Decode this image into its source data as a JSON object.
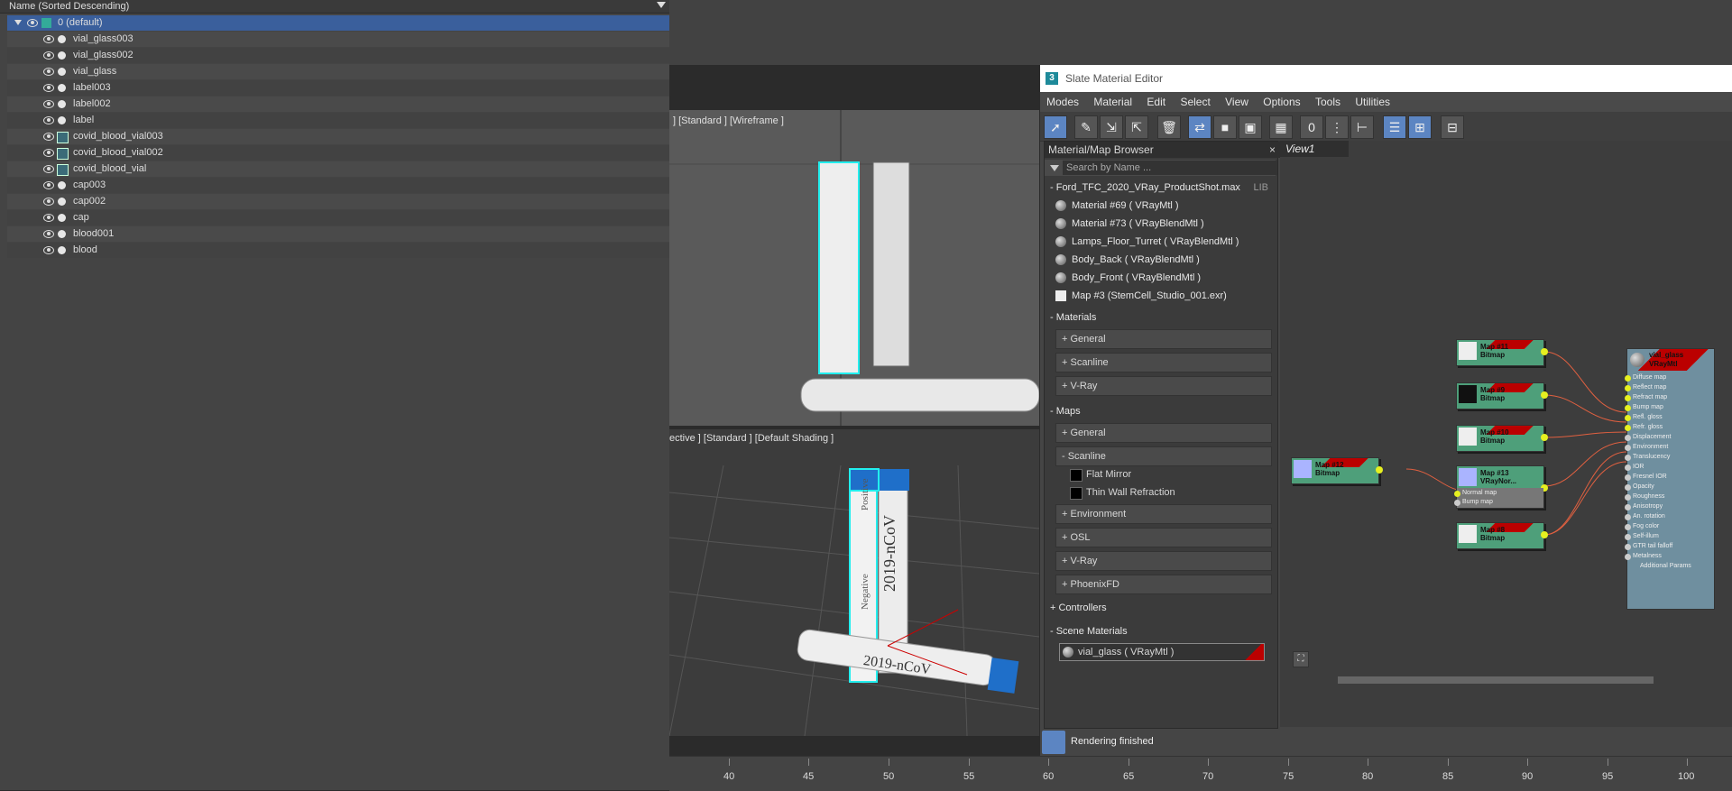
{
  "explorer": {
    "header": "Name (Sorted Descending)",
    "rows": [
      {
        "label": "0 (default)"
      },
      {
        "label": "vial_glass003"
      },
      {
        "label": "vial_glass002"
      },
      {
        "label": "vial_glass"
      },
      {
        "label": "label003"
      },
      {
        "label": "label002"
      },
      {
        "label": "label"
      },
      {
        "label": "covid_blood_vial003"
      },
      {
        "label": "covid_blood_vial002"
      },
      {
        "label": "covid_blood_vial"
      },
      {
        "label": "cap003"
      },
      {
        "label": "cap002"
      },
      {
        "label": "cap"
      },
      {
        "label": "blood001"
      },
      {
        "label": "blood"
      }
    ]
  },
  "viewports": {
    "top_label": "] [Standard ] [Wireframe ]",
    "bottom_label": "ective ] [Standard ] [Default Shading ]",
    "vial_text_1": "2019-nCoV",
    "vial_text_2": "2019-nCoV",
    "vial_text_3": "Positive",
    "vial_text_4": "Negative"
  },
  "timeline": {
    "ticks": [
      "40",
      "45",
      "50",
      "55",
      "60",
      "65",
      "70",
      "75",
      "80",
      "85",
      "90",
      "95",
      "100"
    ]
  },
  "slate": {
    "title": "Slate Material Editor",
    "app_icon": "3",
    "menu": [
      "Modes",
      "Material",
      "Edit",
      "Select",
      "View",
      "Options",
      "Tools",
      "Utilities"
    ],
    "browser": {
      "title": "Material/Map Browser",
      "close": "×",
      "search_placeholder": "Search by Name ...",
      "lib_header": "- Ford_TFC_2020_VRay_ProductShot.max",
      "lib_tag": "LIB",
      "lib_items": [
        "Material #69  ( VRayMtl )",
        "Material #73  ( VRayBlendMtl )",
        "Lamps_Floor_Turret  ( VRayBlendMtl )",
        "Body_Back  ( VRayBlendMtl )",
        "Body_Front  ( VRayBlendMtl )",
        "Map #3 (StemCell_Studio_001.exr)"
      ],
      "materials_header": "- Materials",
      "materials_subs": [
        "+ General",
        "+ Scanline",
        "+ V-Ray"
      ],
      "maps_header": "- Maps",
      "maps_general": "+ General",
      "maps_scanline": "- Scanline",
      "scanline_items": [
        "Flat Mirror",
        "Thin Wall Refraction"
      ],
      "maps_subs": [
        "+ Environment",
        "+ OSL",
        "+ V-Ray",
        "+ PhoenixFD"
      ],
      "controllers_header": "+ Controllers",
      "scene_header": "- Scene Materials",
      "scene_item": "vial_glass  ( VRayMtl )"
    },
    "status": "Rendering finished",
    "view_tab": "View1",
    "nodes": [
      {
        "line1": "Map #11",
        "line2": "Bitmap"
      },
      {
        "line1": "Map #9",
        "line2": "Bitmap"
      },
      {
        "line1": "Map #10",
        "line2": "Bitmap"
      },
      {
        "line1": "Map #13",
        "line2": "VRayNor..."
      },
      {
        "line1": "Map #12",
        "line2": "Bitmap"
      },
      {
        "line1": "Map #8",
        "line2": "Bitmap"
      }
    ],
    "normal_slots": [
      "Normal map",
      "Bump map"
    ],
    "material_node": {
      "title": "vial_glass",
      "subtitle": "VRayMtl",
      "slots": [
        "Diffuse map",
        "Reflect map",
        "Refract map",
        "Bump map",
        "Refl. gloss",
        "Refr. gloss",
        "Displacement",
        "Environment",
        "Translucency",
        "IOR",
        "Fresnel IOR",
        "Opacity",
        "Roughness",
        "Anisotropy",
        "An. rotation",
        "Fog color",
        "Self-illum",
        "GTR tail falloff",
        "Metalness",
        "Additional Params"
      ]
    }
  }
}
